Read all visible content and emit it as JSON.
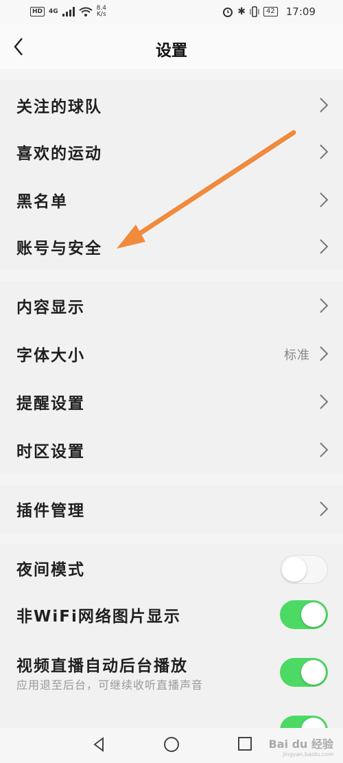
{
  "status_bar": {
    "network": "4G",
    "hd": "HD",
    "speed_value": "8.4",
    "speed_unit": "K/s",
    "battery": "42",
    "time": "17:09"
  },
  "header": {
    "title": "设置"
  },
  "group1": [
    {
      "label": "关注的球队"
    },
    {
      "label": "喜欢的运动"
    },
    {
      "label": "黑名单"
    },
    {
      "label": "账号与安全"
    }
  ],
  "group2": [
    {
      "label": "内容显示"
    },
    {
      "label": "字体大小",
      "value": "标准"
    },
    {
      "label": "提醒设置"
    },
    {
      "label": "时区设置"
    }
  ],
  "group3": [
    {
      "label": "插件管理"
    }
  ],
  "toggles": [
    {
      "label": "夜间模式",
      "on": false
    },
    {
      "label": "非WiFi网络图片显示",
      "on": true
    },
    {
      "label": "视频直播自动后台播放",
      "sublabel": "应用退至后台，可继续收听直播声音",
      "on": true
    },
    {
      "label": "",
      "on": true
    }
  ],
  "annotation": {
    "arrow_color": "#f08a3c"
  },
  "watermark": {
    "brand": "Bai du 经验",
    "url": "jingyan.baidu.com"
  },
  "colors": {
    "toggle_on": "#4cd964",
    "accent_arrow": "#f08a3c"
  }
}
